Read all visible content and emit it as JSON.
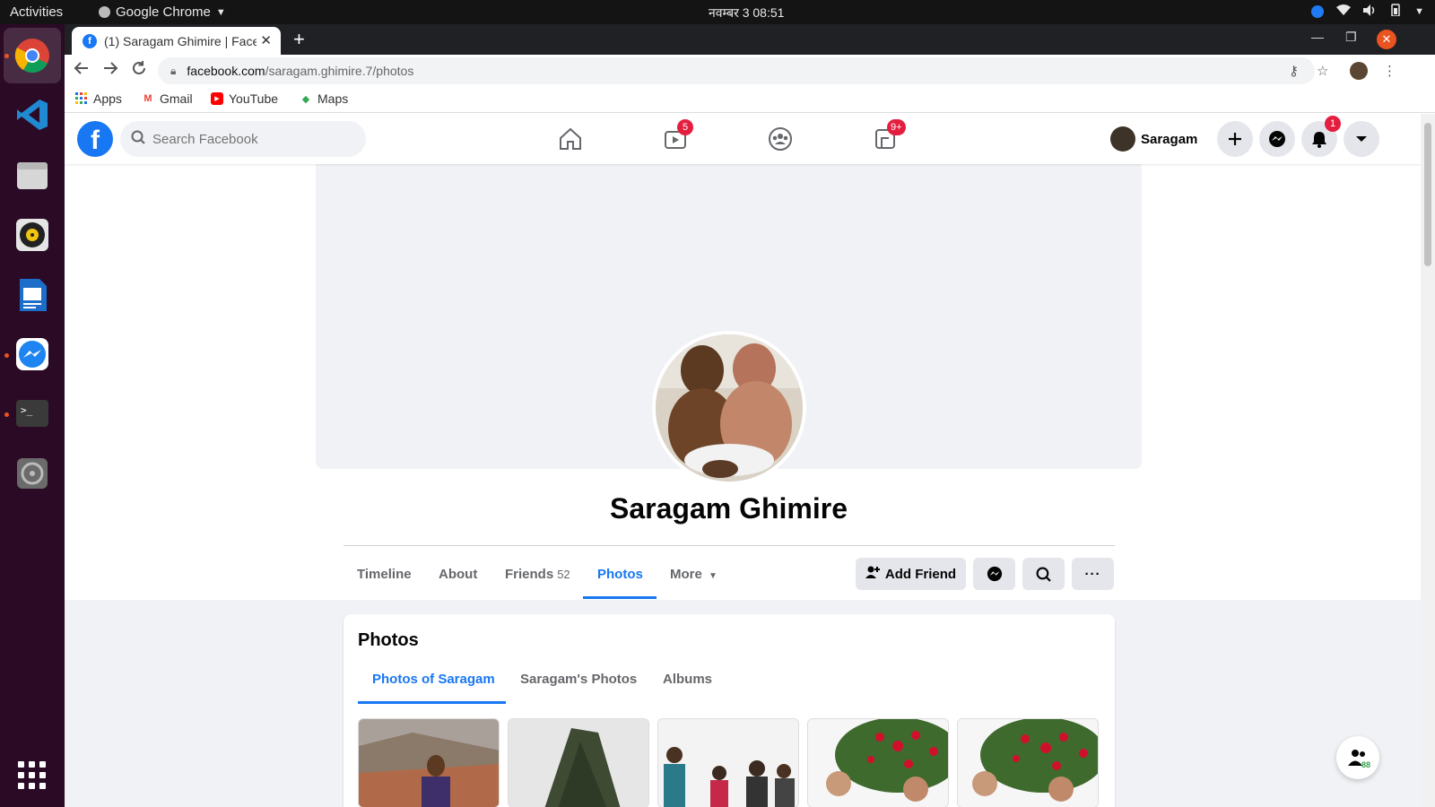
{
  "os": {
    "activities": "Activities",
    "app_name": "Google Chrome",
    "clock": "नवम्बर 3  08:51"
  },
  "browser": {
    "tab_title": "(1) Saragam Ghimire | Face",
    "url_domain": "facebook.com",
    "url_path": "/saragam.ghimire.7/photos",
    "bookmarks": [
      "Apps",
      "Gmail",
      "YouTube",
      "Maps"
    ]
  },
  "fb": {
    "search_placeholder": "Search Facebook",
    "watch_badge": "5",
    "gaming_badge": "9+",
    "me_name": "Saragam",
    "notif_badge": "1",
    "profile_name": "Saragam Ghimire",
    "tabs": {
      "timeline": "Timeline",
      "about": "About",
      "friends": "Friends",
      "friends_count": "52",
      "photos": "Photos",
      "more": "More"
    },
    "add_friend": "Add Friend",
    "photos_section": {
      "title": "Photos",
      "tab1": "Photos of Saragam",
      "tab2": "Saragam's Photos",
      "tab3": "Albums"
    },
    "contacts_count": "88"
  },
  "colors": {
    "brand": "#1877f2",
    "badge": "#e41e3f",
    "dock": "#2b0a26"
  }
}
